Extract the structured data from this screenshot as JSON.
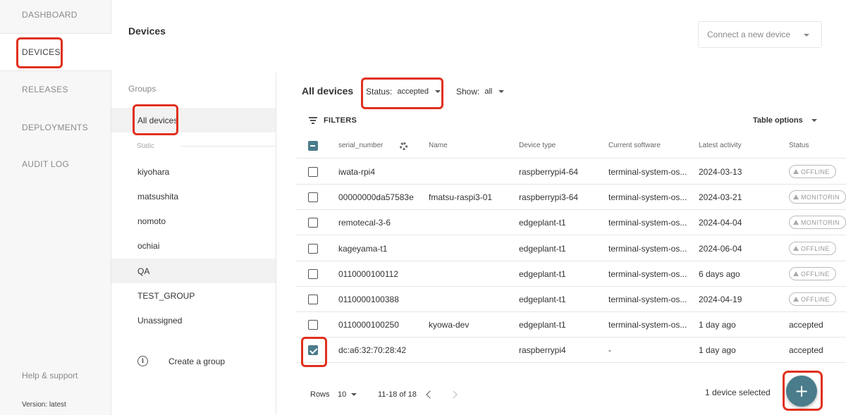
{
  "nav": {
    "items": [
      {
        "label": "DASHBOARD"
      },
      {
        "label": "DEVICES"
      },
      {
        "label": "RELEASES"
      },
      {
        "label": "DEPLOYMENTS"
      },
      {
        "label": "AUDIT LOG"
      }
    ],
    "help": "Help & support",
    "version": "Version: latest"
  },
  "header": {
    "title": "Devices",
    "connect_button": "Connect a new device"
  },
  "groups": {
    "title": "Groups",
    "all_devices": "All devices",
    "static_label": "Static",
    "items": [
      "kiyohara",
      "matsushita",
      "nomoto",
      "ochiai",
      "QA",
      "TEST_GROUP",
      "Unassigned"
    ],
    "create_label": "Create a group",
    "info_glyph": "i"
  },
  "list": {
    "title": "All devices",
    "status_label": "Status:",
    "status_value": "accepted",
    "show_label": "Show:",
    "show_value": "all",
    "filters_label": "FILTERS",
    "table_options": "Table options"
  },
  "table": {
    "columns": [
      "serial_number",
      "Name",
      "Device type",
      "Current software",
      "Latest activity",
      "Status"
    ],
    "rows": [
      {
        "serial": "iwata-rpi4",
        "name": "",
        "type": "raspberrypi4-64",
        "software": "terminal-system-os...",
        "activity": "2024-03-13",
        "status": "OFFLINE",
        "badge": true,
        "checked": false
      },
      {
        "serial": "00000000da57583e",
        "name": "fmatsu-raspi3-01",
        "type": "raspberrypi3-64",
        "software": "terminal-system-os...",
        "activity": "2024-03-21",
        "status": "MONITORIN",
        "badge": true,
        "checked": false
      },
      {
        "serial": "remotecal-3-6",
        "name": "",
        "type": "edgeplant-t1",
        "software": "terminal-system-os...",
        "activity": "2024-04-04",
        "status": "MONITORIN",
        "badge": true,
        "checked": false
      },
      {
        "serial": "kageyama-t1",
        "name": "",
        "type": "edgeplant-t1",
        "software": "terminal-system-os...",
        "activity": "2024-06-04",
        "status": "OFFLINE",
        "badge": true,
        "checked": false
      },
      {
        "serial": "0110000100112",
        "name": "",
        "type": "edgeplant-t1",
        "software": "terminal-system-os...",
        "activity": "6 days ago",
        "status": "OFFLINE",
        "badge": true,
        "checked": false
      },
      {
        "serial": "0110000100388",
        "name": "",
        "type": "edgeplant-t1",
        "software": "terminal-system-os...",
        "activity": "2024-04-19",
        "status": "OFFLINE",
        "badge": true,
        "checked": false
      },
      {
        "serial": "0110000100250",
        "name": "kyowa-dev",
        "type": "edgeplant-t1",
        "software": "terminal-system-os...",
        "activity": "1 day ago",
        "status": "accepted",
        "badge": false,
        "checked": false
      },
      {
        "serial": "dc:a6:32:70:28:42",
        "name": "",
        "type": "raspberrypi4",
        "software": "-",
        "activity": "1 day ago",
        "status": "accepted",
        "badge": false,
        "checked": true
      }
    ]
  },
  "footer": {
    "rows_label": "Rows",
    "rows_value": "10",
    "page_range": "11-18 of 18",
    "selected": "1 device selected",
    "fab_label": "+"
  },
  "colors": {
    "accent": "#4a7c8c",
    "highlight": "#e0301e"
  }
}
